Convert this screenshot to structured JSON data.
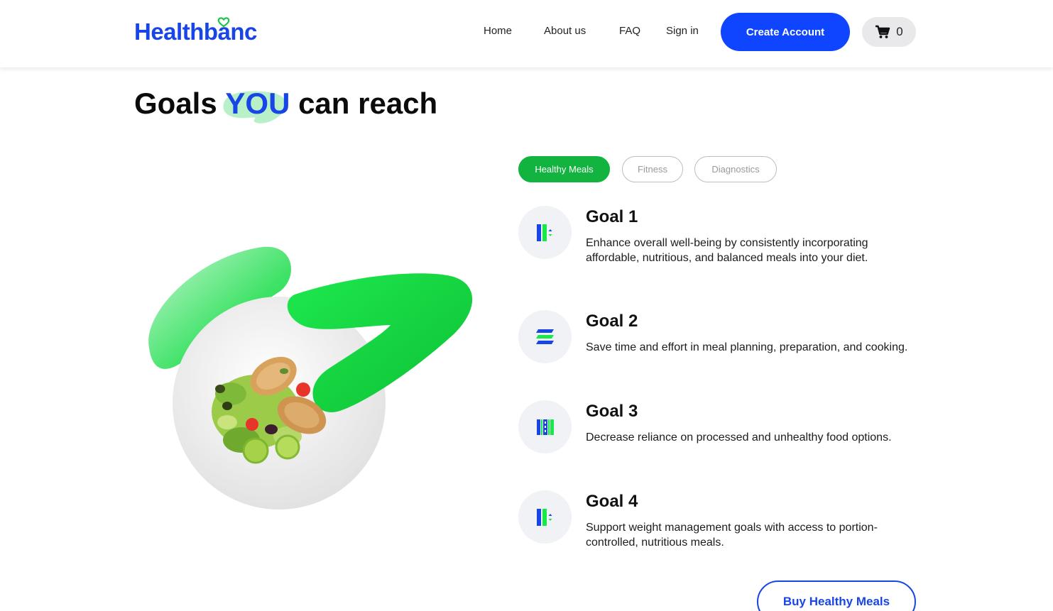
{
  "header": {
    "logo": "Healthbanc",
    "nav": [
      {
        "label": "Home"
      },
      {
        "label": "About us"
      },
      {
        "label": "FAQ"
      },
      {
        "label": "Sign in"
      }
    ],
    "create_account_label": "Create Account",
    "cart_count": "0"
  },
  "hero": {
    "heading_pre": "Goals",
    "heading_highlight": "YOU",
    "heading_post": "can reach"
  },
  "tabs": [
    {
      "label": "Healthy Meals",
      "active": true
    },
    {
      "label": "Fitness",
      "active": false
    },
    {
      "label": "Diagnostics",
      "active": false
    }
  ],
  "goals": [
    {
      "title": "Goal 1",
      "description": "Enhance overall well-being by consistently incorporating affordable, nutritious, and balanced meals into your diet.",
      "icon": "columns-icon"
    },
    {
      "title": "Goal 2",
      "description": "Save time and effort in meal planning, preparation, and cooking.",
      "icon": "stack-icon"
    },
    {
      "title": "Goal 3",
      "description": "Decrease reliance on processed and unhealthy food options.",
      "icon": "barcode-icon"
    },
    {
      "title": "Goal 4",
      "description": "Support weight management goals with access to portion-controlled, nutritious meals.",
      "icon": "columns-icon"
    }
  ],
  "cta": {
    "buy_label": "Buy Healthy Meals"
  },
  "colors": {
    "brand_blue": "#1846e6",
    "button_blue": "#0f45ff",
    "brand_green": "#12b33f",
    "accent_green": "#19e84b"
  }
}
